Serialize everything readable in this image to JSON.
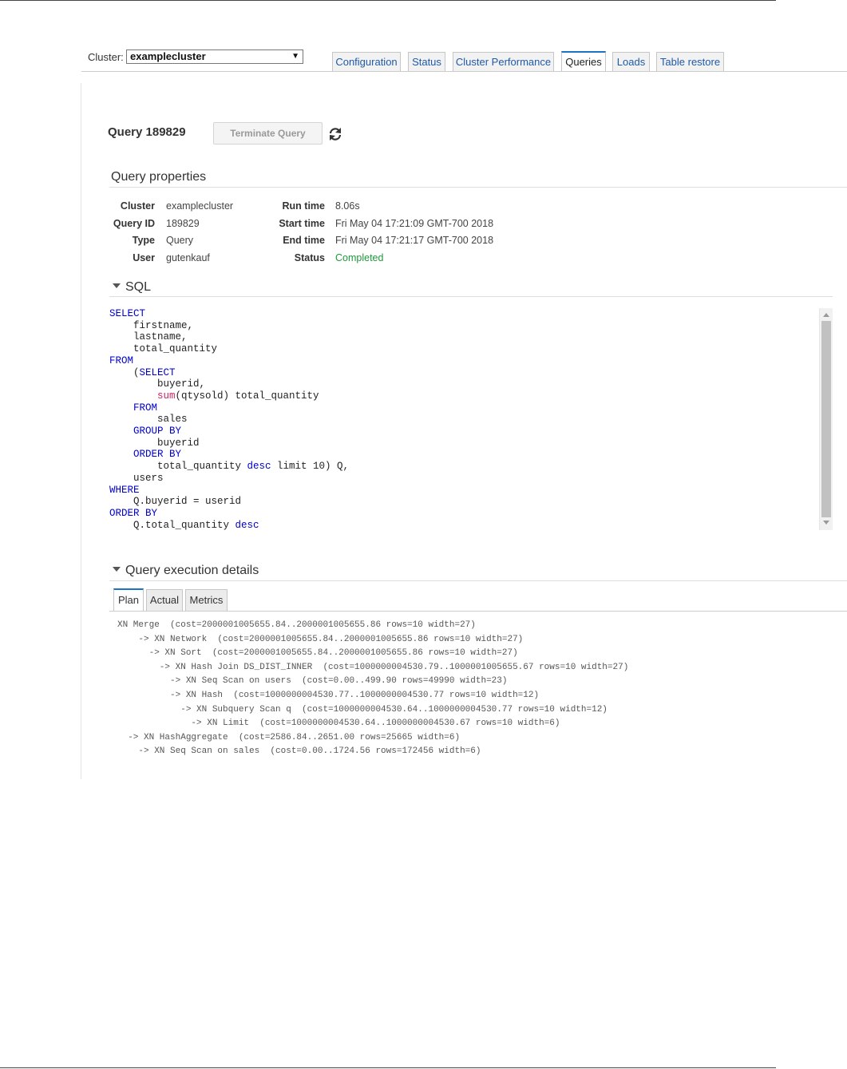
{
  "header": {
    "cluster_label": "Cluster:",
    "cluster_value": "examplecluster",
    "tabs": [
      {
        "label": "Configuration"
      },
      {
        "label": "Status"
      },
      {
        "label": "Cluster Performance"
      },
      {
        "label": "Queries",
        "active": true
      },
      {
        "label": "Loads"
      },
      {
        "label": "Table restore"
      }
    ]
  },
  "query": {
    "title": "Query 189829",
    "terminate_label": "Terminate Query",
    "refresh_icon": "refresh-icon"
  },
  "properties": {
    "section_title": "Query properties",
    "left": [
      {
        "key": "Cluster",
        "value": "examplecluster"
      },
      {
        "key": "Query ID",
        "value": "189829"
      },
      {
        "key": "Type",
        "value": "Query"
      },
      {
        "key": "User",
        "value": "gutenkauf"
      }
    ],
    "right": [
      {
        "key": "Run time",
        "value": "8.06s"
      },
      {
        "key": "Start time",
        "value": "Fri May 04 17:21:09 GMT-700 2018"
      },
      {
        "key": "End time",
        "value": "Fri May 04 17:21:17 GMT-700 2018"
      },
      {
        "key": "Status",
        "value": "Completed"
      }
    ],
    "status_color": "#1d9a3c"
  },
  "sql": {
    "section_title": "SQL",
    "code": "SELECT\n    firstname,\n    lastname,\n    total_quantity\nFROM\n    (SELECT\n        buyerid,\n        sum(qtysold) total_quantity\n    FROM\n        sales\n    GROUP BY\n        buyerid\n    ORDER BY\n        total_quantity desc limit 10) Q,\n    users\nWHERE\n    Q.buyerid = userid\nORDER BY\n    Q.total_quantity desc",
    "keyword_color": "#0000cc",
    "function_color": "#cc2266"
  },
  "execution": {
    "section_title": "Query execution details",
    "tabs": [
      {
        "label": "Plan",
        "active": true
      },
      {
        "label": "Actual"
      },
      {
        "label": "Metrics"
      }
    ],
    "plan": "XN Merge  (cost=2000001005655.84..2000001005655.86 rows=10 width=27)\n    -> XN Network  (cost=2000001005655.84..2000001005655.86 rows=10 width=27)\n      -> XN Sort  (cost=2000001005655.84..2000001005655.86 rows=10 width=27)\n        -> XN Hash Join DS_DIST_INNER  (cost=1000000004530.79..1000001005655.67 rows=10 width=27)\n          -> XN Seq Scan on users  (cost=0.00..499.90 rows=49990 width=23)\n          -> XN Hash  (cost=1000000004530.77..1000000004530.77 rows=10 width=12)\n            -> XN Subquery Scan q  (cost=1000000004530.64..1000000004530.77 rows=10 width=12)\n              -> XN Limit  (cost=1000000004530.64..1000000004530.67 rows=10 width=6)\n  -> XN HashAggregate  (cost=2586.84..2651.00 rows=25665 width=6)\n    -> XN Seq Scan on sales  (cost=0.00..1724.56 rows=172456 width=6)"
  },
  "colors": {
    "link": "#1e5aa8",
    "active_tab_border": "#1c72c4"
  }
}
